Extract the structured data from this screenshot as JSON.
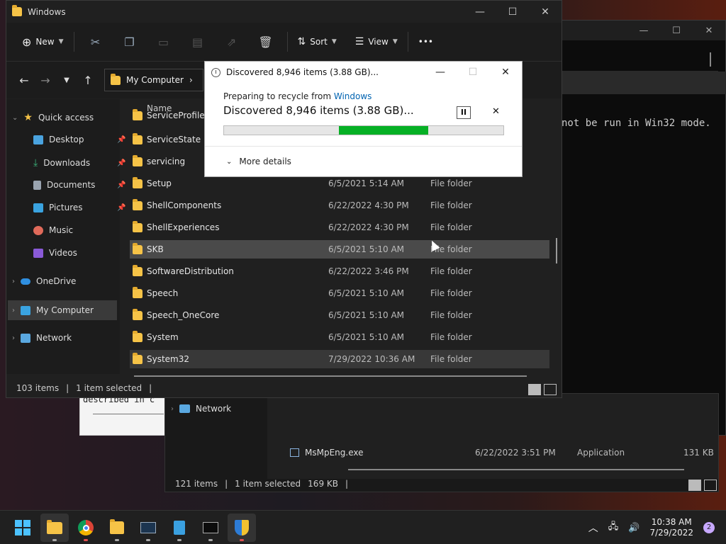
{
  "console": {
    "message": "not be run in Win32 mode."
  },
  "doc": {
    "text": "described in c"
  },
  "explorer2": {
    "nav_network": "Network",
    "file": {
      "name": "MsMpEng.exe",
      "date": "6/22/2022 3:51 PM",
      "type": "Application",
      "size": "131 KB"
    },
    "status": {
      "items": "121 items",
      "selected": "1 item selected",
      "size": "169 KB",
      "sep": "|"
    }
  },
  "explorer": {
    "title": "Windows",
    "toolbar": {
      "new_label": "New",
      "sort_label": "Sort",
      "view_label": "View",
      "more": "•••"
    },
    "address": {
      "location": "My Computer",
      "chevron": "›"
    },
    "column_name": "Name",
    "sidebar": [
      {
        "label": "Quick access",
        "icon": "star-icon"
      },
      {
        "label": "Desktop",
        "icon": "desktop-icon"
      },
      {
        "label": "Downloads",
        "icon": "download-icon"
      },
      {
        "label": "Documents",
        "icon": "document-icon"
      },
      {
        "label": "Pictures",
        "icon": "picture-icon"
      },
      {
        "label": "Music",
        "icon": "music-icon"
      },
      {
        "label": "Videos",
        "icon": "video-icon"
      },
      {
        "label": "OneDrive",
        "icon": "cloud-icon"
      },
      {
        "label": "My Computer",
        "icon": "computer-icon"
      },
      {
        "label": "Network",
        "icon": "network-icon"
      }
    ],
    "files": [
      {
        "name": "ServiceProfiles",
        "date": "",
        "type": ""
      },
      {
        "name": "ServiceState",
        "date": "",
        "type": ""
      },
      {
        "name": "servicing",
        "date": "",
        "type": ""
      },
      {
        "name": "Setup",
        "date": "6/5/2021 5:14 AM",
        "type": "File folder"
      },
      {
        "name": "ShellComponents",
        "date": "6/22/2022 4:30 PM",
        "type": "File folder"
      },
      {
        "name": "ShellExperiences",
        "date": "6/22/2022 4:30 PM",
        "type": "File folder"
      },
      {
        "name": "SKB",
        "date": "6/5/2021 5:10 AM",
        "type": "File folder"
      },
      {
        "name": "SoftwareDistribution",
        "date": "6/22/2022 3:46 PM",
        "type": "File folder"
      },
      {
        "name": "Speech",
        "date": "6/5/2021 5:10 AM",
        "type": "File folder"
      },
      {
        "name": "Speech_OneCore",
        "date": "6/5/2021 5:10 AM",
        "type": "File folder"
      },
      {
        "name": "System",
        "date": "6/5/2021 5:10 AM",
        "type": "File folder"
      },
      {
        "name": "System32",
        "date": "7/29/2022 10:36 AM",
        "type": "File folder"
      }
    ],
    "status": {
      "items": "103 items",
      "selected": "1 item selected",
      "sep": "|"
    }
  },
  "dialog": {
    "title": "Discovered 8,946 items (3.88 GB)...",
    "subtitle_prefix": "Preparing to recycle from ",
    "subtitle_link": "Windows",
    "main": "Discovered 8,946 items (3.88 GB)...",
    "progress": {
      "start": 0.41,
      "end": 0.73
    },
    "more_details": "More details"
  },
  "taskbar": {
    "time": "10:38 AM",
    "date": "7/29/2022",
    "notifications": "2",
    "colors": {
      "green": "#06b025",
      "accent": "#0078d4"
    }
  }
}
